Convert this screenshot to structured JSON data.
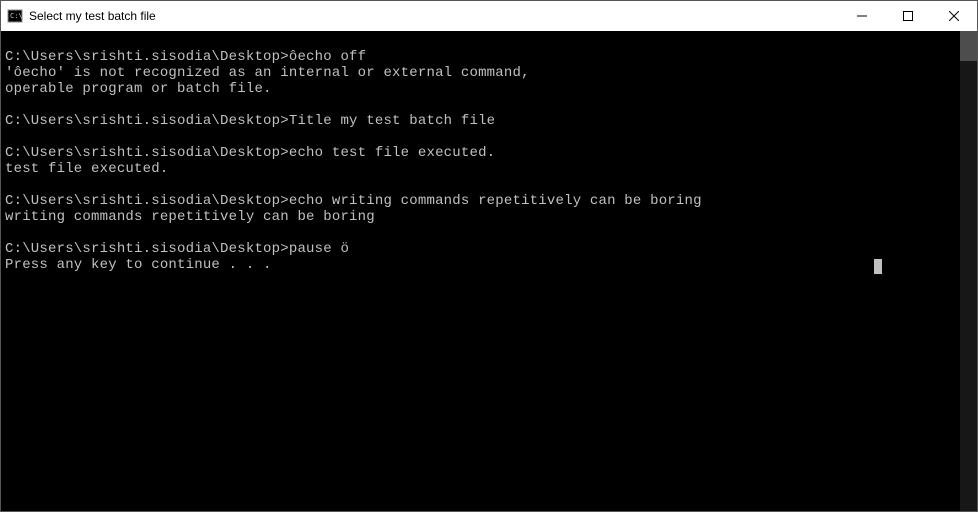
{
  "titlebar": {
    "title": "Select my test batch file"
  },
  "terminal": {
    "lines": [
      "",
      "C:\\Users\\srishti.sisodia\\Desktop>ôecho off",
      "'ôecho' is not recognized as an internal or external command,",
      "operable program or batch file.",
      "",
      "C:\\Users\\srishti.sisodia\\Desktop>Title my test batch file",
      "",
      "C:\\Users\\srishti.sisodia\\Desktop>echo test file executed.",
      "test file executed.",
      "",
      "C:\\Users\\srishti.sisodia\\Desktop>echo writing commands repetitively can be boring",
      "writing commands repetitively can be boring",
      "",
      "C:\\Users\\srishti.sisodia\\Desktop>pause ö",
      "Press any key to continue . . ."
    ]
  }
}
